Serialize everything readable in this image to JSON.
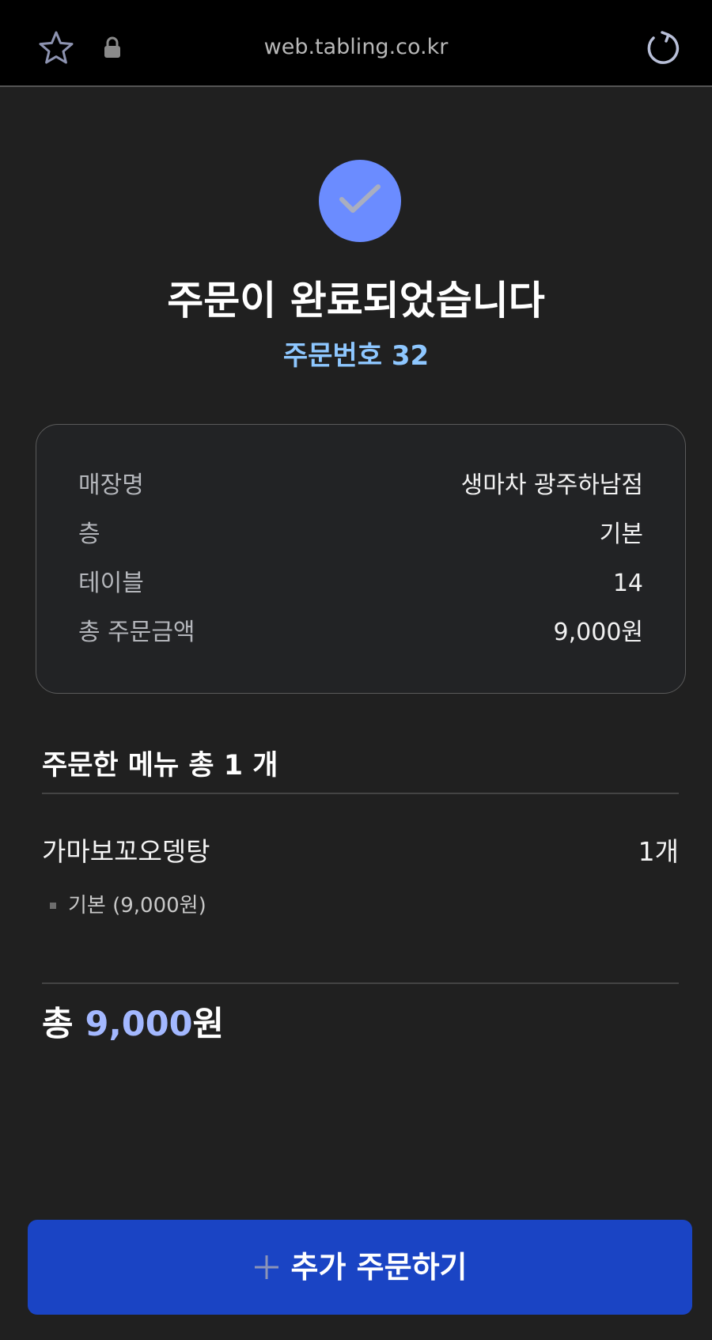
{
  "browser": {
    "url": "web.tabling.co.kr",
    "icons": [
      "star-icon",
      "lock-icon",
      "reload-icon"
    ]
  },
  "status": {
    "icon": "check-icon",
    "title": "주문이 완료되었습니다",
    "order_number": "주문번호 32"
  },
  "info": {
    "rows": [
      {
        "label": "매장명",
        "value": "생마차 광주하남점"
      },
      {
        "label": "층",
        "value": "기본"
      },
      {
        "label": "테이블",
        "value": "14"
      },
      {
        "label": "총 주문금액",
        "value": "9,000원"
      }
    ]
  },
  "menu": {
    "header": "주문한 메뉴 총 1 개",
    "items": [
      {
        "name": "가마보꼬오뎅탕",
        "qty": "1개",
        "option": "기본 (9,000원)"
      }
    ]
  },
  "total": {
    "prefix": "총 ",
    "amount": "9,000",
    "suffix": "원"
  },
  "actions": {
    "add_order_label": "추가 주문하기"
  },
  "colors": {
    "accent_blue": "#1a44c4",
    "check_circle": "#6b8cff",
    "order_number": "#8ec7ff",
    "total_amount": "#a3b8ff",
    "background": "#202020"
  }
}
